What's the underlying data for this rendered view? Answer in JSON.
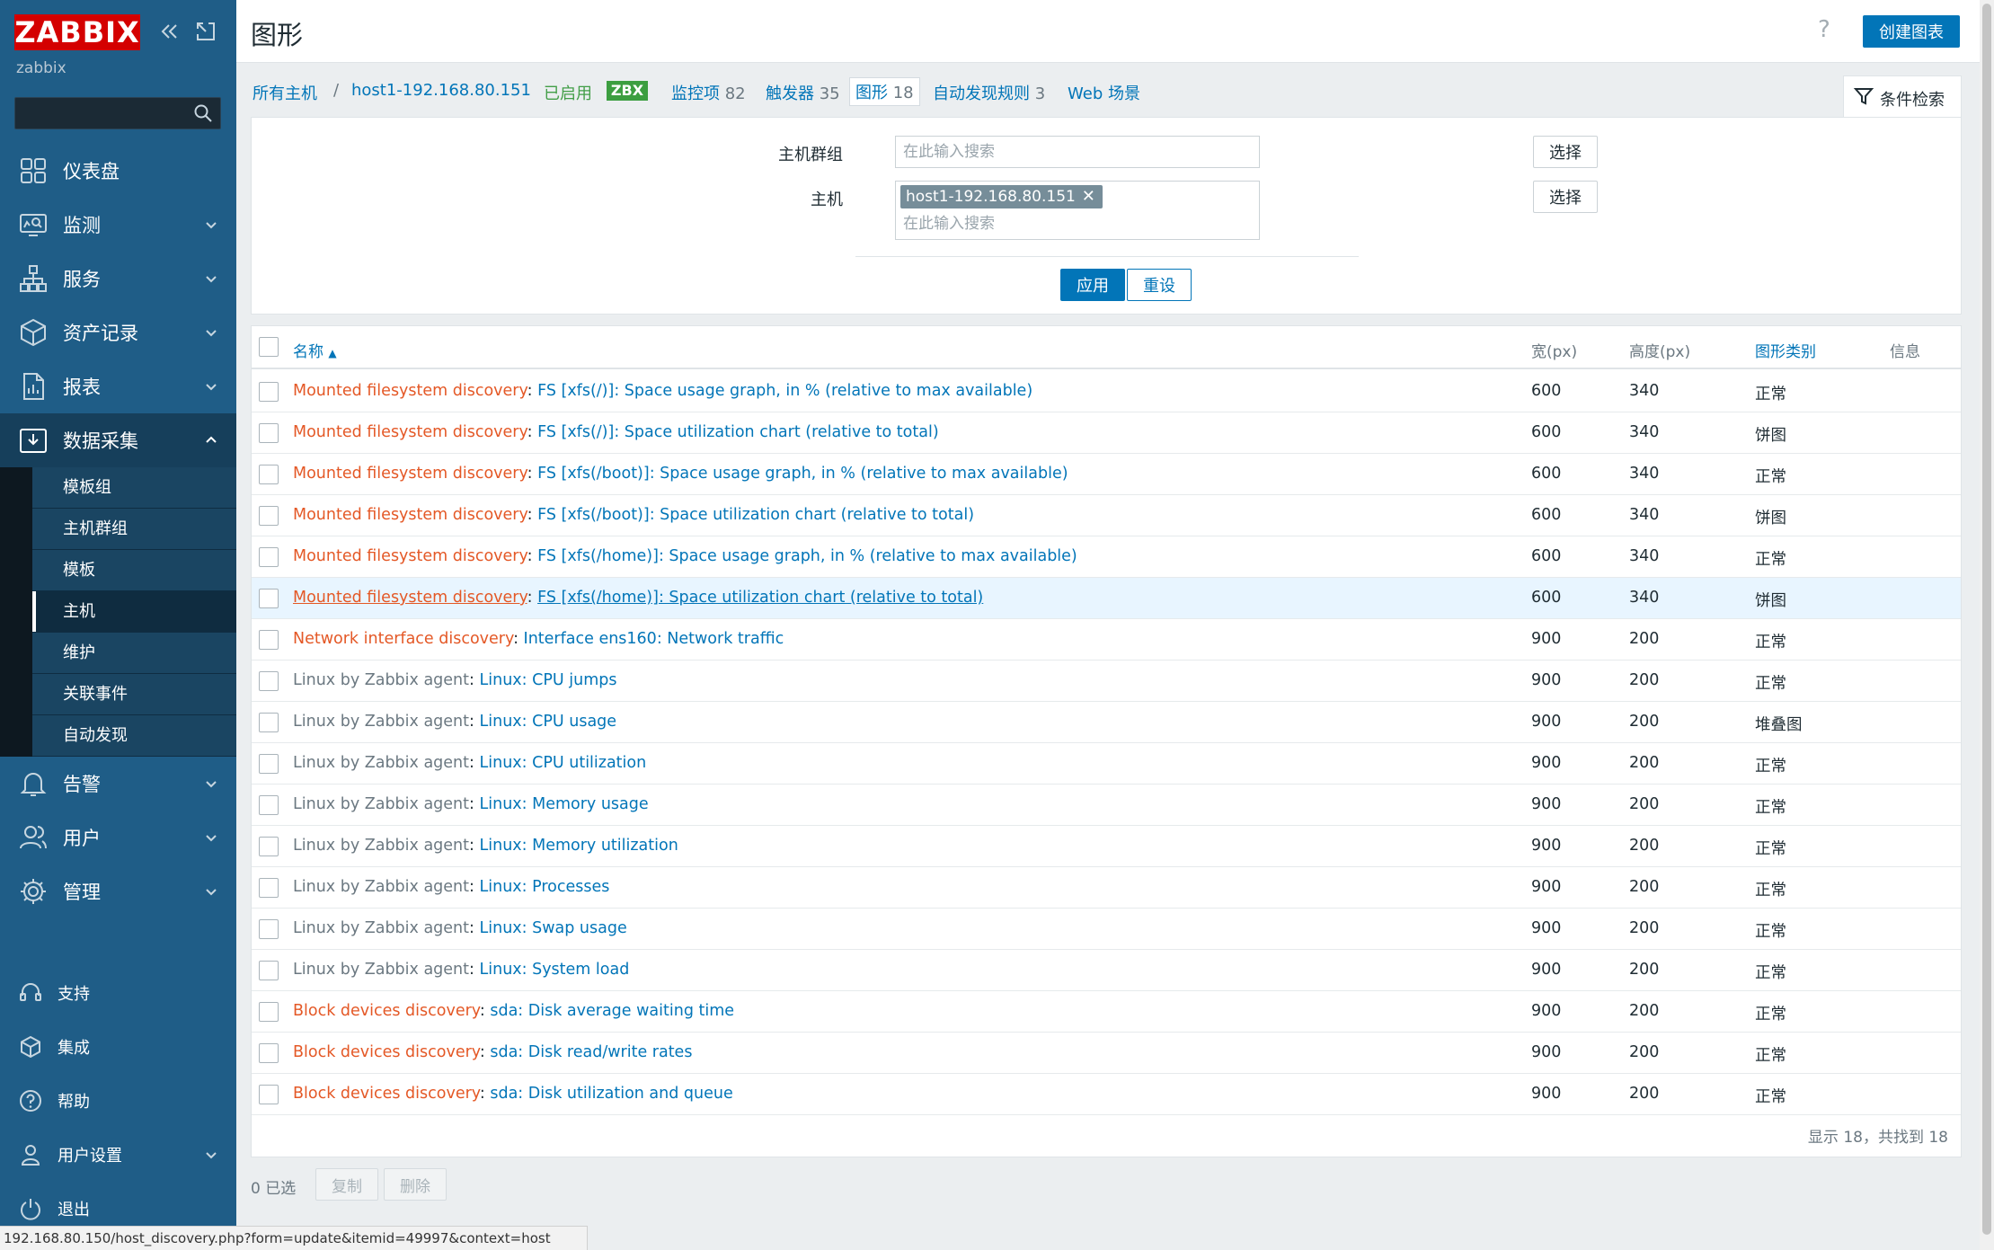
{
  "sidebar": {
    "logo": "ZABBIX",
    "server_name": "zabbix",
    "search_placeholder": "",
    "menu": [
      {
        "label": "仪表盘",
        "icon": "dashboard-icon"
      },
      {
        "label": "监测",
        "icon": "monitoring-icon"
      },
      {
        "label": "服务",
        "icon": "services-icon"
      },
      {
        "label": "资产记录",
        "icon": "inventory-icon"
      },
      {
        "label": "报表",
        "icon": "reports-icon"
      },
      {
        "label": "数据采集",
        "icon": "data-collection-icon"
      },
      {
        "label": "告警",
        "icon": "alerts-icon"
      },
      {
        "label": "用户",
        "icon": "users-icon"
      },
      {
        "label": "管理",
        "icon": "administration-icon"
      }
    ],
    "submenu": [
      "模板组",
      "主机群组",
      "模板",
      "主机",
      "维护",
      "关联事件",
      "自动发现"
    ],
    "submenu_selected": "主机",
    "bottom_menu": [
      {
        "label": "支持",
        "icon": "support-icon"
      },
      {
        "label": "集成",
        "icon": "integrations-icon"
      },
      {
        "label": "帮助",
        "icon": "help-icon"
      },
      {
        "label": "用户设置",
        "icon": "user-settings-icon"
      },
      {
        "label": "退出",
        "icon": "signout-icon"
      }
    ]
  },
  "header": {
    "title": "图形",
    "help": "?",
    "create_button": "创建图表"
  },
  "nav": {
    "all_hosts": "所有主机",
    "separator": "/",
    "host": "host1-192.168.80.151",
    "enabled": "已启用",
    "zbx": "ZBX",
    "items_label": "监控项",
    "items_count": "82",
    "triggers_label": "触发器",
    "triggers_count": "35",
    "graphs_label": "图形",
    "graphs_count": "18",
    "discovery_label": "自动发现规则",
    "discovery_count": "3",
    "web_label": "Web 场景",
    "filter_tab": "条件检索"
  },
  "filter": {
    "host_group_label": "主机群组",
    "host_group_placeholder": "在此输入搜索",
    "host_label": "主机",
    "host_chip": "host1-192.168.80.151",
    "host_placeholder": "在此输入搜索",
    "select_label": "选择",
    "apply": "应用",
    "reset": "重设"
  },
  "table": {
    "columns": {
      "name": "名称",
      "width": "宽(px)",
      "height": "高度(px)",
      "type": "图形类别",
      "info": "信息"
    },
    "rows": [
      {
        "prefix": "Mounted filesystem discovery",
        "prefix_style": "red",
        "name": "FS [xfs(/)]: Space usage graph, in % (relative to max available)",
        "width": "600",
        "height": "340",
        "type": "正常"
      },
      {
        "prefix": "Mounted filesystem discovery",
        "prefix_style": "red",
        "name": "FS [xfs(/)]: Space utilization chart (relative to total)",
        "width": "600",
        "height": "340",
        "type": "饼图"
      },
      {
        "prefix": "Mounted filesystem discovery",
        "prefix_style": "red",
        "name": "FS [xfs(/boot)]: Space usage graph, in % (relative to max available)",
        "width": "600",
        "height": "340",
        "type": "正常"
      },
      {
        "prefix": "Mounted filesystem discovery",
        "prefix_style": "red",
        "name": "FS [xfs(/boot)]: Space utilization chart (relative to total)",
        "width": "600",
        "height": "340",
        "type": "饼图"
      },
      {
        "prefix": "Mounted filesystem discovery",
        "prefix_style": "red",
        "name": "FS [xfs(/home)]: Space usage graph, in % (relative to max available)",
        "width": "600",
        "height": "340",
        "type": "正常"
      },
      {
        "prefix": "Mounted filesystem discovery",
        "prefix_style": "red",
        "name": "FS [xfs(/home)]: Space utilization chart (relative to total)",
        "width": "600",
        "height": "340",
        "type": "饼图"
      },
      {
        "prefix": "Network interface discovery",
        "prefix_style": "red",
        "name": "Interface ens160: Network traffic",
        "width": "900",
        "height": "200",
        "type": "正常"
      },
      {
        "prefix": "Linux by Zabbix agent",
        "prefix_style": "gray",
        "name": "Linux: CPU jumps",
        "width": "900",
        "height": "200",
        "type": "正常"
      },
      {
        "prefix": "Linux by Zabbix agent",
        "prefix_style": "gray",
        "name": "Linux: CPU usage",
        "width": "900",
        "height": "200",
        "type": "堆叠图"
      },
      {
        "prefix": "Linux by Zabbix agent",
        "prefix_style": "gray",
        "name": "Linux: CPU utilization",
        "width": "900",
        "height": "200",
        "type": "正常"
      },
      {
        "prefix": "Linux by Zabbix agent",
        "prefix_style": "gray",
        "name": "Linux: Memory usage",
        "width": "900",
        "height": "200",
        "type": "正常"
      },
      {
        "prefix": "Linux by Zabbix agent",
        "prefix_style": "gray",
        "name": "Linux: Memory utilization",
        "width": "900",
        "height": "200",
        "type": "正常"
      },
      {
        "prefix": "Linux by Zabbix agent",
        "prefix_style": "gray",
        "name": "Linux: Processes",
        "width": "900",
        "height": "200",
        "type": "正常"
      },
      {
        "prefix": "Linux by Zabbix agent",
        "prefix_style": "gray",
        "name": "Linux: Swap usage",
        "width": "900",
        "height": "200",
        "type": "正常"
      },
      {
        "prefix": "Linux by Zabbix agent",
        "prefix_style": "gray",
        "name": "Linux: System load",
        "width": "900",
        "height": "200",
        "type": "正常"
      },
      {
        "prefix": "Block devices discovery",
        "prefix_style": "red",
        "name": "sda: Disk average waiting time",
        "width": "900",
        "height": "200",
        "type": "正常"
      },
      {
        "prefix": "Block devices discovery",
        "prefix_style": "red",
        "name": "sda: Disk read/write rates",
        "width": "900",
        "height": "200",
        "type": "正常"
      },
      {
        "prefix": "Block devices discovery",
        "prefix_style": "red",
        "name": "sda: Disk utilization and queue",
        "width": "900",
        "height": "200",
        "type": "正常"
      }
    ],
    "footer": "显示 18，共找到 18"
  },
  "actions": {
    "selected": "0 已选",
    "copy": "复制",
    "delete": "删除"
  },
  "status_url": "192.168.80.150/host_discovery.php?form=update&itemid=49997&context=host",
  "colors": {
    "sidebar": "#1f5d87",
    "accent": "#0275b8",
    "logo": "#d40000",
    "template_prefix": "#e45826",
    "enabled": "#429e47"
  }
}
